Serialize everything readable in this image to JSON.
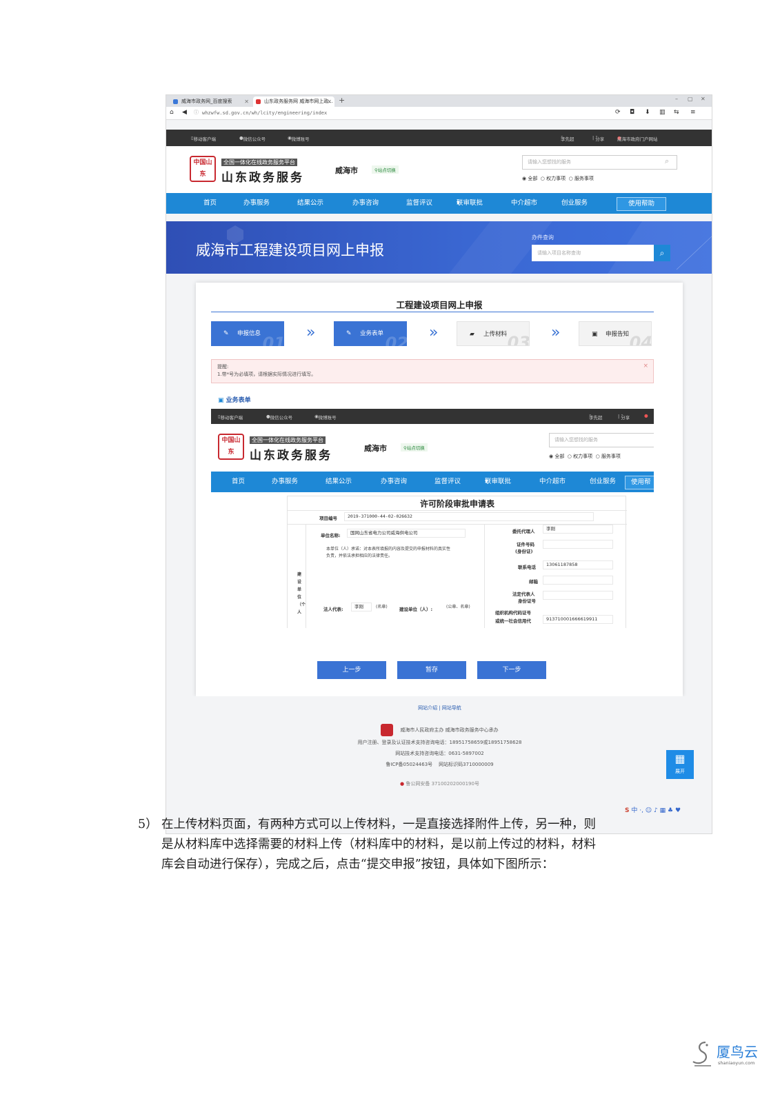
{
  "browser": {
    "tabs": [
      "威海市政务网_百度搜索",
      "山东政务服务网 威海市网上政..."
    ],
    "add_tab": "+",
    "window_controls": [
      "–",
      "▢",
      "✕"
    ],
    "url_prefix": "ⓘ",
    "url": "whzwfw.sd.gov.cn/wh/lcity/engineering/index"
  },
  "portal": {
    "topbar": {
      "left": [
        "移动客户端",
        "微信公众号",
        "微博账号"
      ],
      "right": [
        "李先超",
        "分享",
        "威海市政府门户网站"
      ]
    },
    "logo_seal": "中国山东",
    "logo_sub": "全国一体化在线政务服务平台",
    "logo_main": "山东政务服务",
    "city": "威海市",
    "city_switch": "站点切换",
    "search_placeholder": "请输入您想找的服务",
    "radios": [
      "全部",
      "权力事项",
      "服务事项"
    ],
    "nav": [
      "首页",
      "办事服务",
      "结果公示",
      "办事咨询",
      "监督评议",
      "联审联批",
      "中介超市",
      "创业服务"
    ],
    "help": "使用帮助"
  },
  "banner": {
    "title": "威海市工程建设项目网上申报",
    "query_label": "办件查询",
    "query_placeholder": "请输入项目名称查询"
  },
  "card": {
    "title": "工程建设项目网上申报",
    "steps": [
      {
        "label": "申报信息",
        "num": "01"
      },
      {
        "label": "业务表单",
        "num": "02"
      },
      {
        "label": "上传材料",
        "num": "03"
      },
      {
        "label": "申报告知",
        "num": "04"
      }
    ],
    "alert_title": "提醒:",
    "alert_text": "1.带*号为必填项，请根据实际情况进行填写。",
    "section_title": "业务表单",
    "inner_nav_help": "使用帮",
    "form": {
      "title": "许可阶段审批申请表",
      "project_no_label": "项目编号",
      "project_no": "2019-371000-44-02-026632",
      "unit_name_label": "单位名称:",
      "unit_name": "国网山东省电力公司威海供电公司",
      "promise_line1": "本单位（人）承诺：对本表所填报的内容及提交的申报材料的真实性",
      "promise_line2": "负责，并依法承担相应的法律责任。",
      "side_label": "建设单位（个人",
      "legal_rep_label": "法人代表:",
      "legal_rep": "李刚",
      "sign_hint": "(名章)",
      "build_unit_label": "建设单位（人）:",
      "seal_hint": "(公章、名章)",
      "agent_label": "委托代理人",
      "agent": "李刚",
      "id_label_1": "证件号码",
      "id_label_2": "(身份证)",
      "phone_label": "联系电话",
      "phone": "13061187858",
      "email_label": "邮箱",
      "legal_id_label_1": "法定代表人",
      "legal_id_label_2": "身份证号",
      "org_code_label": "组织机构代码证号",
      "credit_label": "或统一社会信用代",
      "credit_value": "913710001666619911"
    },
    "buttons": [
      "上一步",
      "暂存",
      "下一步"
    ]
  },
  "footer": {
    "links": [
      "网站介绍",
      "网站导航"
    ],
    "sponsor": "威海市人民政府主办 威海市政务服务中心承办",
    "support1": "用户注册、登录及认证技术支持咨询电话：18951758659或18951758628",
    "support2": "网站技术支持咨询电话：0631-5897002",
    "icp": "鲁ICP备05024463号",
    "site_code": "网站标识码3710000009",
    "police": "鲁公网安备 37100202000190号",
    "expand": "展开",
    "ime": "中 ·, ☺ ♪ ▦ ♣ ♥"
  },
  "paragraph": {
    "num": "5）",
    "lines": [
      "在上传材料页面，有两种方式可以上传材料，一是直接选择附件上传，另一种，则",
      "是从材料库中选择需要的材料上传（材料库中的材料，是以前上传过的材料，材料",
      "库会自动进行保存），完成之后，点击“提交申报”按钮，具体如下图所示："
    ]
  },
  "watermark": {
    "brand": "厦鸟云",
    "domain": "shaniaoyun.com"
  },
  "colors": {
    "nav_blue": "#1e88d6",
    "step_blue": "#3a73d4",
    "banner_blue": "#3a67d2",
    "seal_red": "#c8282f"
  }
}
